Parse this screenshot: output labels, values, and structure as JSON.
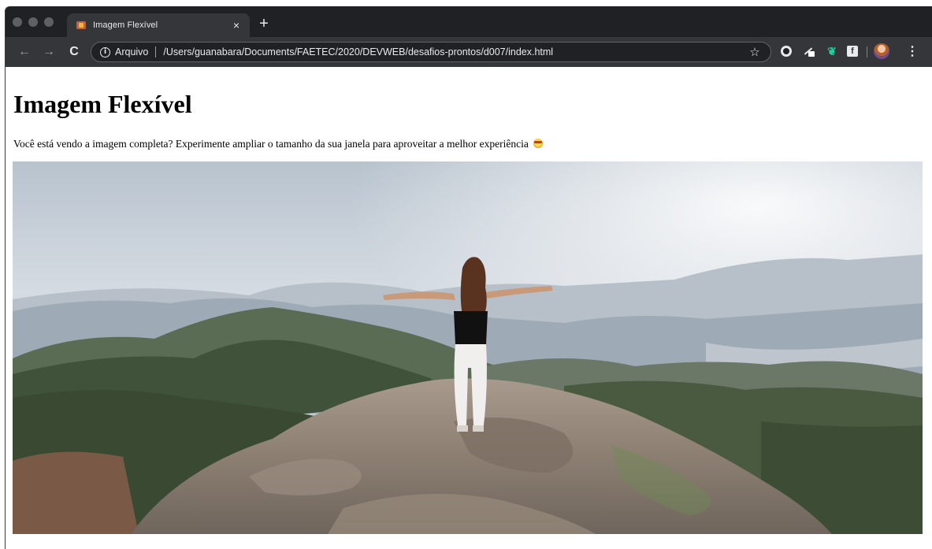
{
  "browser": {
    "tab": {
      "title": "Imagem Flexível",
      "close": "×",
      "favicon": "html5-favicon-icon"
    },
    "new_tab": "+",
    "nav": {
      "back": "←",
      "forward": "→",
      "reload": "C"
    },
    "omnibox": {
      "info": "i",
      "scheme_label": "Arquivo",
      "url": "/Users/guanabara/Documents/FAETEC/2020/DEVWEB/desafios-prontos/d007/index.html",
      "bookmark": "☆"
    },
    "extensions": [
      "shield-icon",
      "pen-icon",
      "leaf-icon",
      "facebook-icon"
    ],
    "facebook_letter": "f",
    "menu": "⋮"
  },
  "page": {
    "title": "Imagem Flexível",
    "intro": "Você está vendo a imagem completa? Experimente ampliar o tamanho da sua janela para aproveitar a melhor experiência"
  },
  "colors": {
    "chrome_dark": "#202124",
    "chrome_toolbar": "#35363a",
    "chrome_text": "#e8eaed",
    "page_bg": "#ffffff",
    "extension_green": "#1fd1a0"
  }
}
